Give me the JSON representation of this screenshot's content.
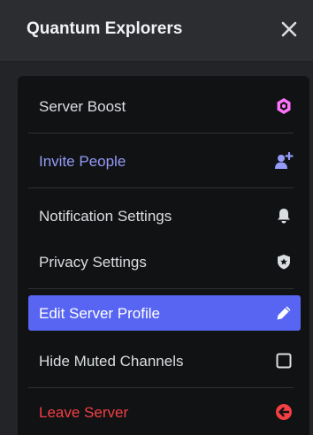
{
  "header": {
    "server_name": "Quantum Explorers"
  },
  "menu": {
    "server_boost": "Server Boost",
    "invite_people": "Invite People",
    "notification_settings": "Notification Settings",
    "privacy_settings": "Privacy Settings",
    "edit_server_profile": "Edit Server Profile",
    "hide_muted_channels": "Hide Muted Channels",
    "leave_server": "Leave Server"
  },
  "icons": {
    "close": "close-icon",
    "server_boost": "boost-gem-icon",
    "invite_people": "add-user-icon",
    "notification_settings": "bell-icon",
    "privacy_settings": "shield-star-icon",
    "edit_server_profile": "pencil-icon",
    "hide_muted_channels": "checkbox-icon",
    "leave_server": "leave-arrow-icon"
  },
  "colors": {
    "boost": "#ff73fa",
    "accent": "#949cf7",
    "active_bg": "#5865f2",
    "danger": "#f23f43"
  }
}
